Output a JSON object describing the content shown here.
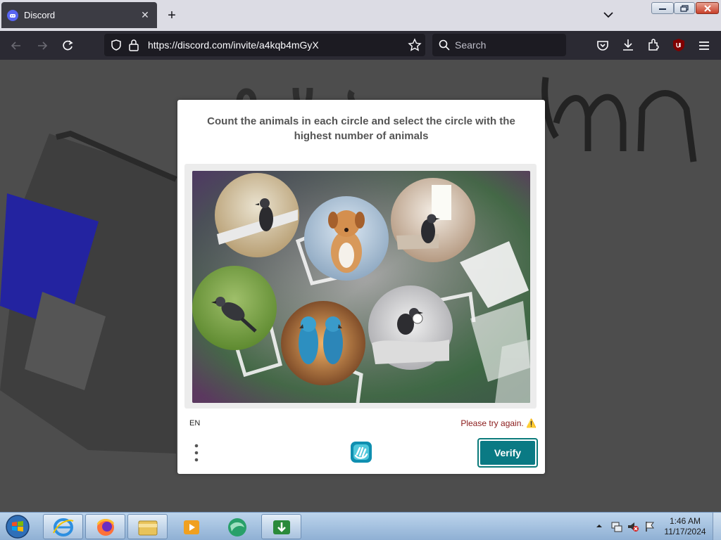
{
  "browser": {
    "tab_title": "Discord",
    "url": "https://discord.com/invite/a4kqb4mGyX",
    "search_placeholder": "Search"
  },
  "captcha": {
    "prompt": "Count the animals in each circle and select the circle with the highest number of animals",
    "language": "EN",
    "error_text": "Please try again. ⚠️",
    "verify_label": "Verify"
  },
  "taskbar": {
    "time": "1:46 AM",
    "date": "11/17/2024"
  },
  "colors": {
    "accent": "#0a7a84",
    "error": "#8a1a1a",
    "browser_chrome": "#2b2a33",
    "discord_brand": "#5865f2"
  }
}
